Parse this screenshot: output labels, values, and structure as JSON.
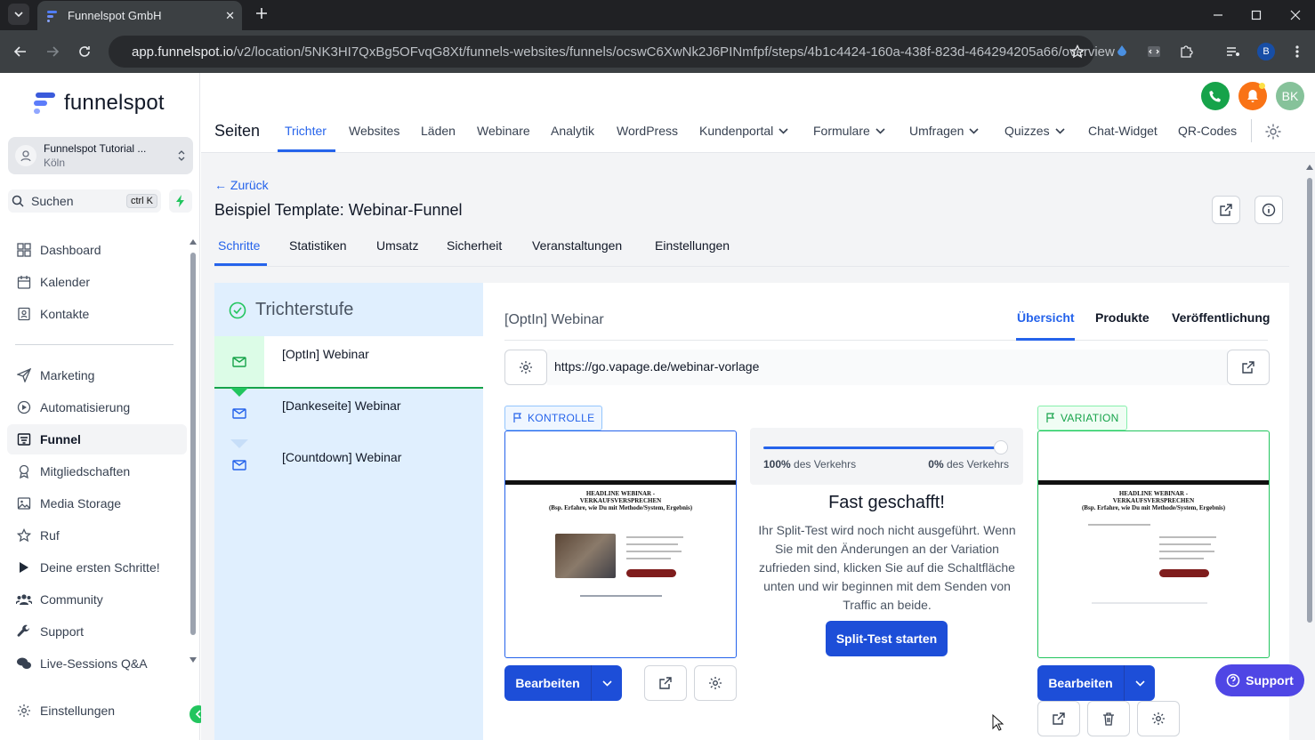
{
  "browser": {
    "tab_title": "Funnelspot GmbH",
    "url_host": "app.funnelspot.io",
    "url_path": "/v2/location/5NK3HI7QxBg5OFvqG8Xt/funnels-websites/funnels/ocswC6XwNk2J6PINmfpf/steps/4b1c4424-160a-438f-823d-464294205a66/overview",
    "profile_initial": "B"
  },
  "sidebar": {
    "logo_text": "funnelspot",
    "account_name": "Funnelspot Tutorial ...",
    "account_location": "Köln",
    "search_label": "Suchen",
    "search_shortcut": "ctrl K",
    "items": [
      {
        "label": "Dashboard",
        "icon": "dashboard-icon"
      },
      {
        "label": "Kalender",
        "icon": "calendar-icon"
      },
      {
        "label": "Kontakte",
        "icon": "contacts-icon"
      },
      {
        "label": "Marketing",
        "icon": "send-icon"
      },
      {
        "label": "Automatisierung",
        "icon": "automation-icon"
      },
      {
        "label": "Funnel",
        "icon": "funnel-icon"
      },
      {
        "label": "Mitgliedschaften",
        "icon": "award-icon"
      },
      {
        "label": "Media Storage",
        "icon": "image-icon"
      },
      {
        "label": "Ruf",
        "icon": "star-icon"
      },
      {
        "label": "Deine ersten Schritte!",
        "icon": "play-icon"
      },
      {
        "label": "Community",
        "icon": "users-icon"
      },
      {
        "label": "Support",
        "icon": "wrench-icon"
      },
      {
        "label": "Live-Sessions Q&A",
        "icon": "chat-icon"
      }
    ],
    "settings_label": "Einstellungen"
  },
  "topnav": {
    "title": "Seiten",
    "items": [
      "Trichter",
      "Websites",
      "Läden",
      "Webinare",
      "Analytik",
      "WordPress",
      "Kundenportal",
      "Formulare",
      "Umfragen",
      "Quizzes",
      "Chat-Widget",
      "QR-Codes"
    ],
    "user_initials": "BK"
  },
  "funnel": {
    "back_label": "← Zurück",
    "title": "Beispiel Template: Webinar-Funnel",
    "tabs": [
      "Schritte",
      "Statistiken",
      "Umsatz",
      "Sicherheit",
      "Veranstaltungen",
      "Einstellungen"
    ],
    "steps_header": "Trichterstufe",
    "steps": [
      "[OptIn] Webinar",
      "[Dankeseite] Webinar",
      "[Countdown] Webinar"
    ]
  },
  "step_detail": {
    "title": "[OptIn] Webinar",
    "tabs": [
      "Übersicht",
      "Produkte",
      "Veröffentlichung"
    ],
    "url": "https://go.vapage.de/webinar-vorlage",
    "control_label": "KONTROLLE",
    "variation_label": "VARIATION",
    "traffic_left_pct": "100%",
    "traffic_right_pct": "0%",
    "traffic_suffix": " des Verkehrs",
    "heading": "Fast geschafft!",
    "text": "Ihr Split-Test wird noch nicht ausgeführt. Wenn Sie mit den Änderungen an der Variation zufrieden sind, klicken Sie auf die Schaltfläche unten und wir beginnen mit dem Senden von Traffic an beide.",
    "start_button": "Split-Test starten",
    "edit_button": "Bearbeiten",
    "thumb_headline": "HEADLINE WEBINAR - VERKAUFSVERSPRECHEN",
    "thumb_sub": "(Bsp. Erfahre, wie Du mit Methode/System, Ergebnis)"
  },
  "support_label": "Support"
}
